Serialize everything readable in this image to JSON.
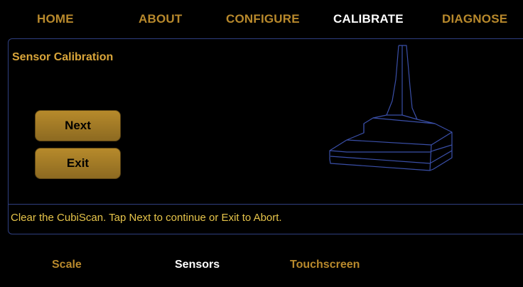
{
  "nav": {
    "tabs": [
      {
        "label": "HOME"
      },
      {
        "label": "ABOUT"
      },
      {
        "label": "CONFIGURE"
      },
      {
        "label": "CALIBRATE",
        "active": true
      },
      {
        "label": "DIAGNOSE"
      }
    ]
  },
  "panel": {
    "title": "Sensor Calibration",
    "next_label": "Next",
    "exit_label": "Exit",
    "status": "Clear the CubiScan. Tap Next to continue or Exit to Abort."
  },
  "subnav": {
    "tabs": [
      {
        "label": "Scale"
      },
      {
        "label": "Sensors",
        "active": true
      },
      {
        "label": "Touchscreen"
      }
    ]
  },
  "colors": {
    "background": "#000000",
    "tab_inactive": "#b8892c",
    "tab_active": "#ffffff",
    "panel_border": "#2f3f80",
    "button_fill": "#b78a2b",
    "status_text": "#e6c44a",
    "figure_line": "#3a4fa8"
  },
  "icons": {
    "figure": "cubiscan-wireframe-icon"
  }
}
